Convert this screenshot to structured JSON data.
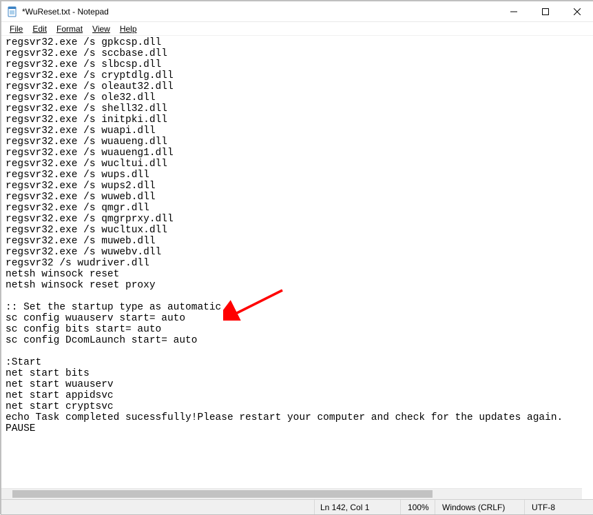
{
  "titlebar": {
    "title": "*WuReset.txt - Notepad"
  },
  "menu": {
    "file": "File",
    "edit": "Edit",
    "format": "Format",
    "view": "View",
    "help": "Help"
  },
  "editor": {
    "content": "regsvr32.exe /s gpkcsp.dll\nregsvr32.exe /s sccbase.dll\nregsvr32.exe /s slbcsp.dll\nregsvr32.exe /s cryptdlg.dll\nregsvr32.exe /s oleaut32.dll\nregsvr32.exe /s ole32.dll\nregsvr32.exe /s shell32.dll\nregsvr32.exe /s initpki.dll\nregsvr32.exe /s wuapi.dll\nregsvr32.exe /s wuaueng.dll\nregsvr32.exe /s wuaueng1.dll\nregsvr32.exe /s wucltui.dll\nregsvr32.exe /s wups.dll\nregsvr32.exe /s wups2.dll\nregsvr32.exe /s wuweb.dll\nregsvr32.exe /s qmgr.dll\nregsvr32.exe /s qmgrprxy.dll\nregsvr32.exe /s wucltux.dll\nregsvr32.exe /s muweb.dll\nregsvr32.exe /s wuwebv.dll\nregsvr32 /s wudriver.dll\nnetsh winsock reset\nnetsh winsock reset proxy\n\n:: Set the startup type as automatic\nsc config wuauserv start= auto\nsc config bits start= auto\nsc config DcomLaunch start= auto\n\n:Start\nnet start bits\nnet start wuauserv\nnet start appidsvc\nnet start cryptsvc\necho Task completed sucessfully!Please restart your computer and check for the updates again.\nPAUSE"
  },
  "statusbar": {
    "position": "Ln 142, Col 1",
    "zoom": "100%",
    "line_ending": "Windows (CRLF)",
    "encoding": "UTF-8"
  },
  "annotation": {
    "arrow_color": "#ff0000"
  }
}
